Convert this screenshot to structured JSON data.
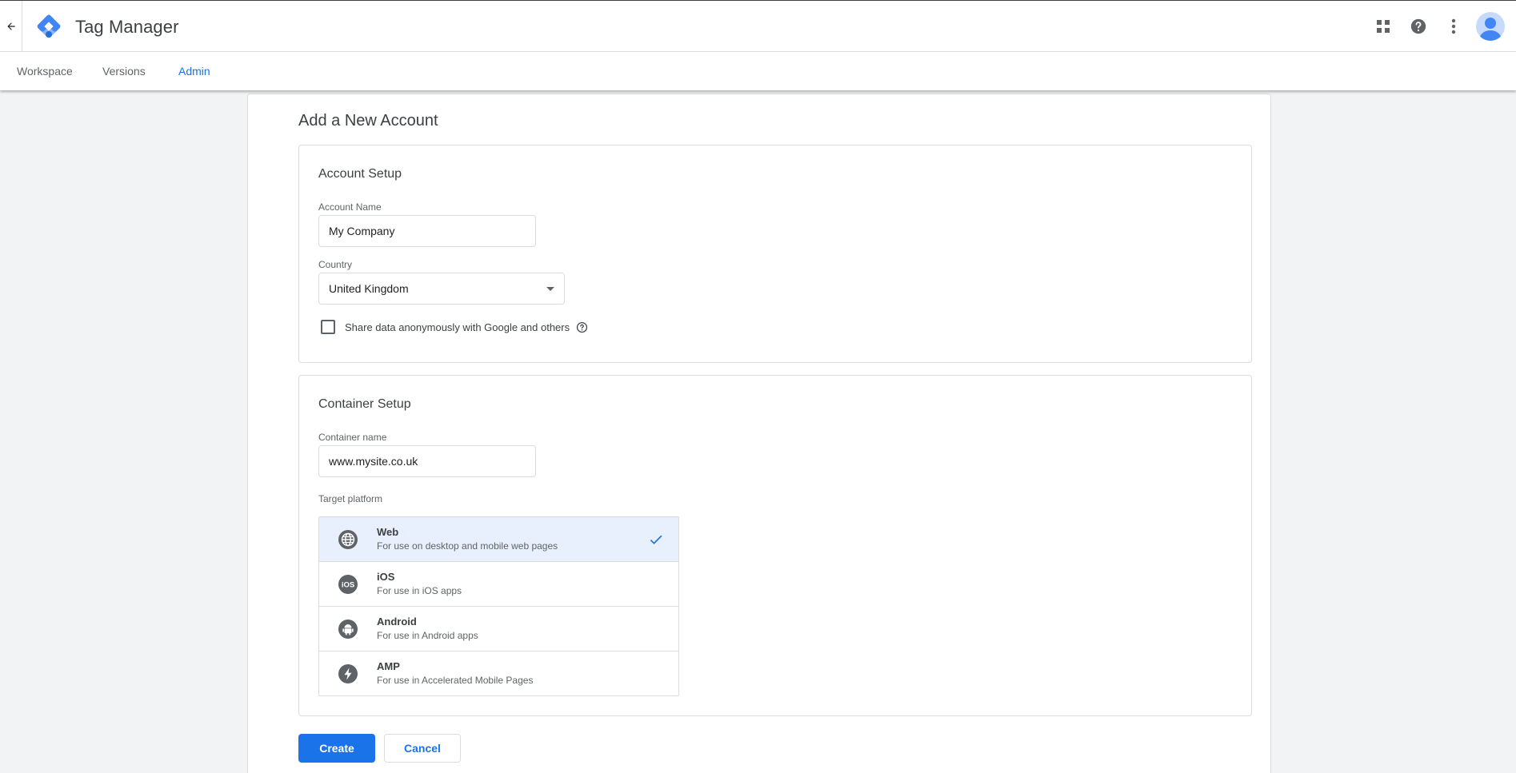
{
  "header": {
    "app_title": "Tag Manager",
    "icons": [
      "back-arrow-icon",
      "tag-manager-logo",
      "apps-grid-icon",
      "help-icon",
      "more-vert-icon",
      "account-avatar"
    ]
  },
  "subnav": {
    "tabs": [
      {
        "label": "Workspace",
        "active": false
      },
      {
        "label": "Versions",
        "active": false
      },
      {
        "label": "Admin",
        "active": true
      }
    ]
  },
  "page": {
    "title": "Add a New Account"
  },
  "account_setup": {
    "title": "Account Setup",
    "account_name_label": "Account Name",
    "account_name_value": "My Company",
    "country_label": "Country",
    "country_value": "United Kingdom",
    "share_data_label": "Share data anonymously with Google and others",
    "share_data_checked": false
  },
  "container_setup": {
    "title": "Container Setup",
    "container_name_label": "Container name",
    "container_name_value": "www.mysite.co.uk",
    "target_platform_label": "Target platform",
    "platforms": [
      {
        "name": "Web",
        "description": "For use on desktop and mobile web pages",
        "selected": true
      },
      {
        "name": "iOS",
        "description": "For use in iOS apps",
        "selected": false
      },
      {
        "name": "Android",
        "description": "For use in Android apps",
        "selected": false
      },
      {
        "name": "AMP",
        "description": "For use in Accelerated Mobile Pages",
        "selected": false
      }
    ]
  },
  "actions": {
    "create_label": "Create",
    "cancel_label": "Cancel"
  },
  "colors": {
    "accent": "#1a73e8",
    "selected_bg": "#e8f0fe",
    "border": "#dadce0",
    "page_bg": "#f1f3f4"
  }
}
